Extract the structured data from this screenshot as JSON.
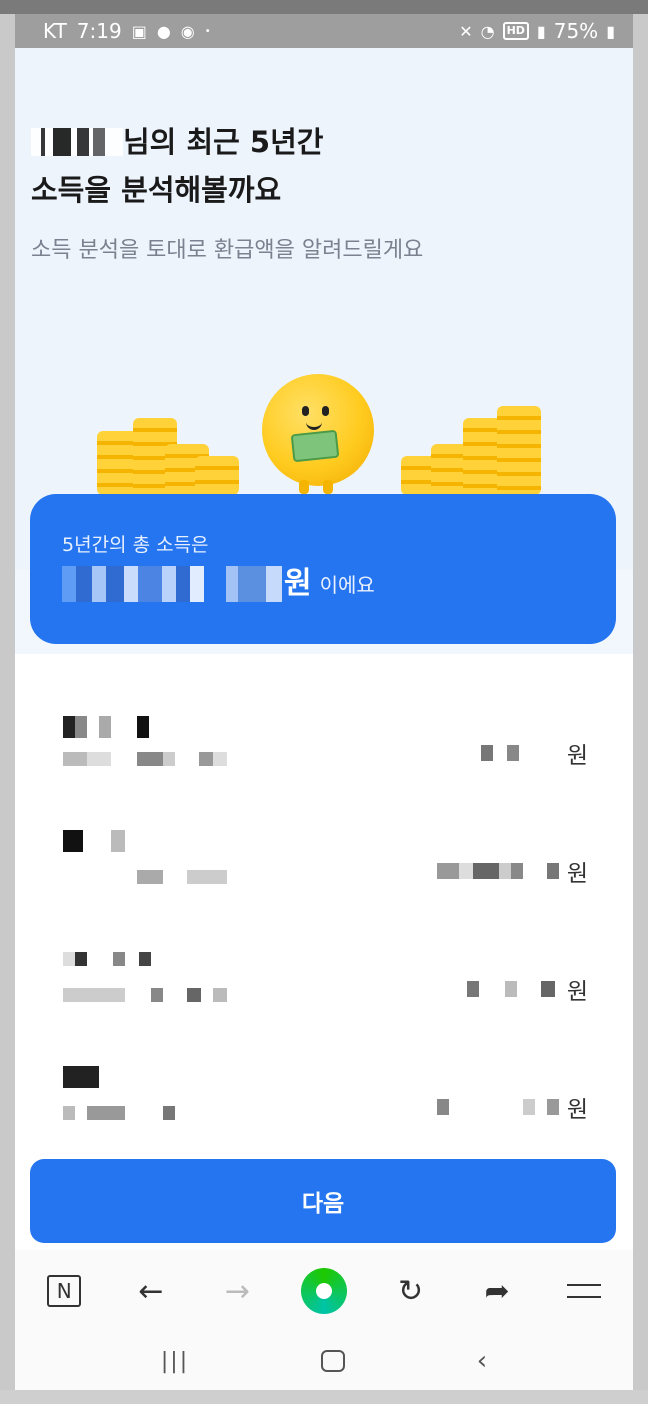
{
  "status_bar": {
    "carrier": "KT",
    "time": "7:19",
    "notification_icons": [
      "gallery-icon",
      "kakaotalk-icon",
      "message-icon",
      "dot-icon"
    ],
    "system_icons": [
      "mute-icon",
      "wifi-icon",
      "hd-voice-icon",
      "signal-icon"
    ],
    "hd_label": "HD",
    "battery_percent": "75%"
  },
  "header": {
    "title_suffix": "님의 최근 5년간",
    "title_line2": "소득을 분석해볼까요",
    "subtitle": "소득 분석을 토대로 환급액을 알려드릴게요"
  },
  "total": {
    "label": "5년간의 총 소득은",
    "amount_unit": "원",
    "suffix": "이에요"
  },
  "income_list": [
    {
      "amount_unit": "원"
    },
    {
      "amount_unit": "원"
    },
    {
      "amount_unit": "원"
    },
    {
      "amount_unit": "원"
    }
  ],
  "next_button": {
    "label": "다음"
  },
  "browser_bar": {
    "logo_label": "N",
    "icons": [
      "naver-n-icon",
      "back-arrow-icon",
      "forward-arrow-icon",
      "green-home-icon",
      "refresh-icon",
      "share-icon",
      "menu-icon"
    ]
  },
  "nav_bar": {
    "icons": [
      "recent-apps-icon",
      "home-icon",
      "back-icon"
    ]
  },
  "colors": {
    "primary_blue": "#2575f0",
    "hero_background": "#eef4fc",
    "coin_yellow": "#ffd23a"
  }
}
